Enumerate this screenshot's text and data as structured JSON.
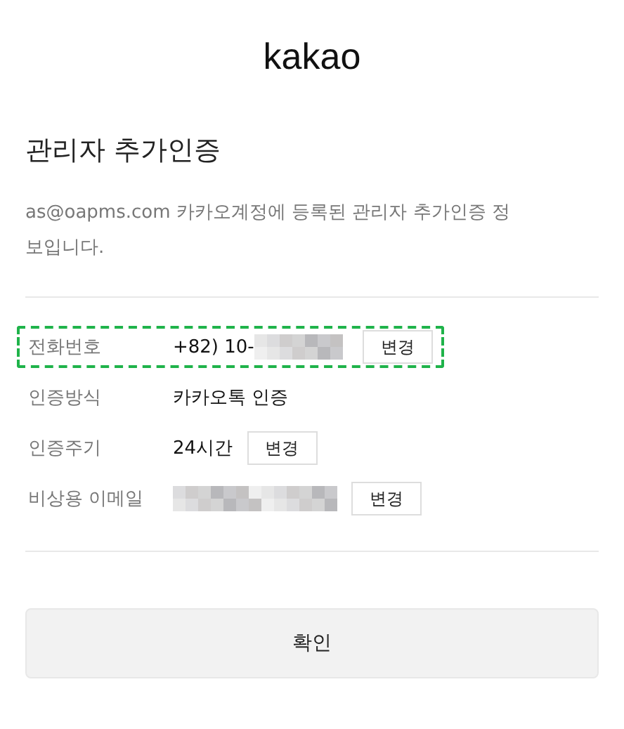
{
  "logo": "kakao",
  "title": "관리자 추가인증",
  "description": "as@oapms.com 카카오계정에 등록된 관리자 추가인증 정보입니다.",
  "rows": [
    {
      "kind": "redacted",
      "label": "전화번호",
      "value": "+82) 10-",
      "button": "변경",
      "highlighted": true
    },
    {
      "kind": "text",
      "label": "인증방식",
      "value": "카카오톡 인증",
      "highlighted": false
    },
    {
      "kind": "text",
      "label": "인증주기",
      "value": "24시간",
      "button": "변경",
      "highlighted": false
    },
    {
      "kind": "redacted",
      "label": "비상용 이메일",
      "button": "변경",
      "highlighted": false
    }
  ],
  "confirm_button": "확인"
}
